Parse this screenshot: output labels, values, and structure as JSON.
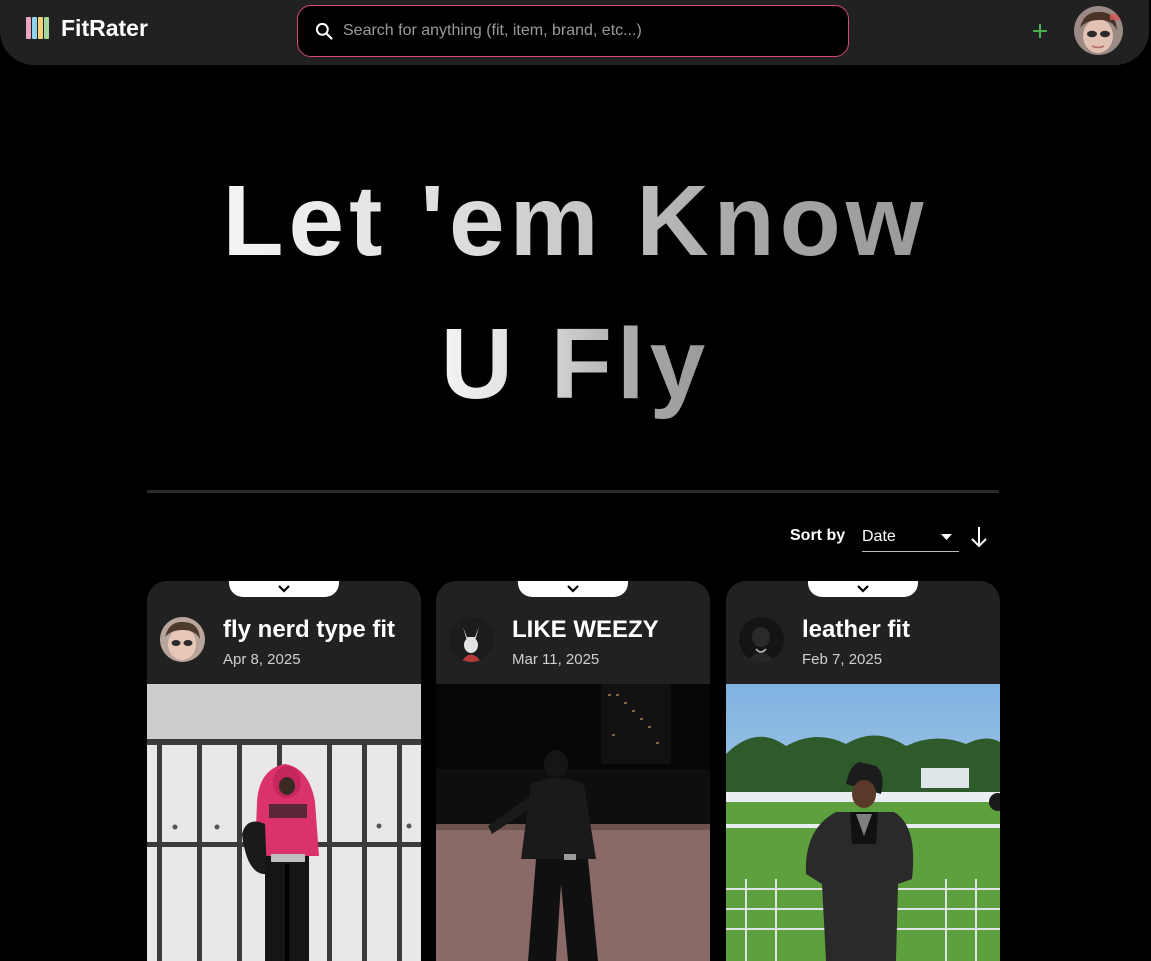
{
  "app": {
    "name": "FitRater"
  },
  "search": {
    "placeholder": "Search for anything (fit, item, brand, etc...)"
  },
  "header": {
    "add_icon": "plus-icon",
    "avatar": "user-avatar"
  },
  "hero": {
    "line1": "Let 'em Know",
    "line2": "U Fly"
  },
  "sort": {
    "label": "Sort by",
    "value": "Date",
    "direction": "descending"
  },
  "colors": {
    "accent": "#d04a7c",
    "add": "#4caf50",
    "card_bg": "#212121",
    "bar_bg": "#212121"
  },
  "posts": [
    {
      "title": "fly nerd type fit",
      "date": "Apr 8, 2025"
    },
    {
      "title": "LIKE WEEZY",
      "date": "Mar 11, 2025"
    },
    {
      "title": "leather fit",
      "date": "Feb 7, 2025"
    }
  ]
}
